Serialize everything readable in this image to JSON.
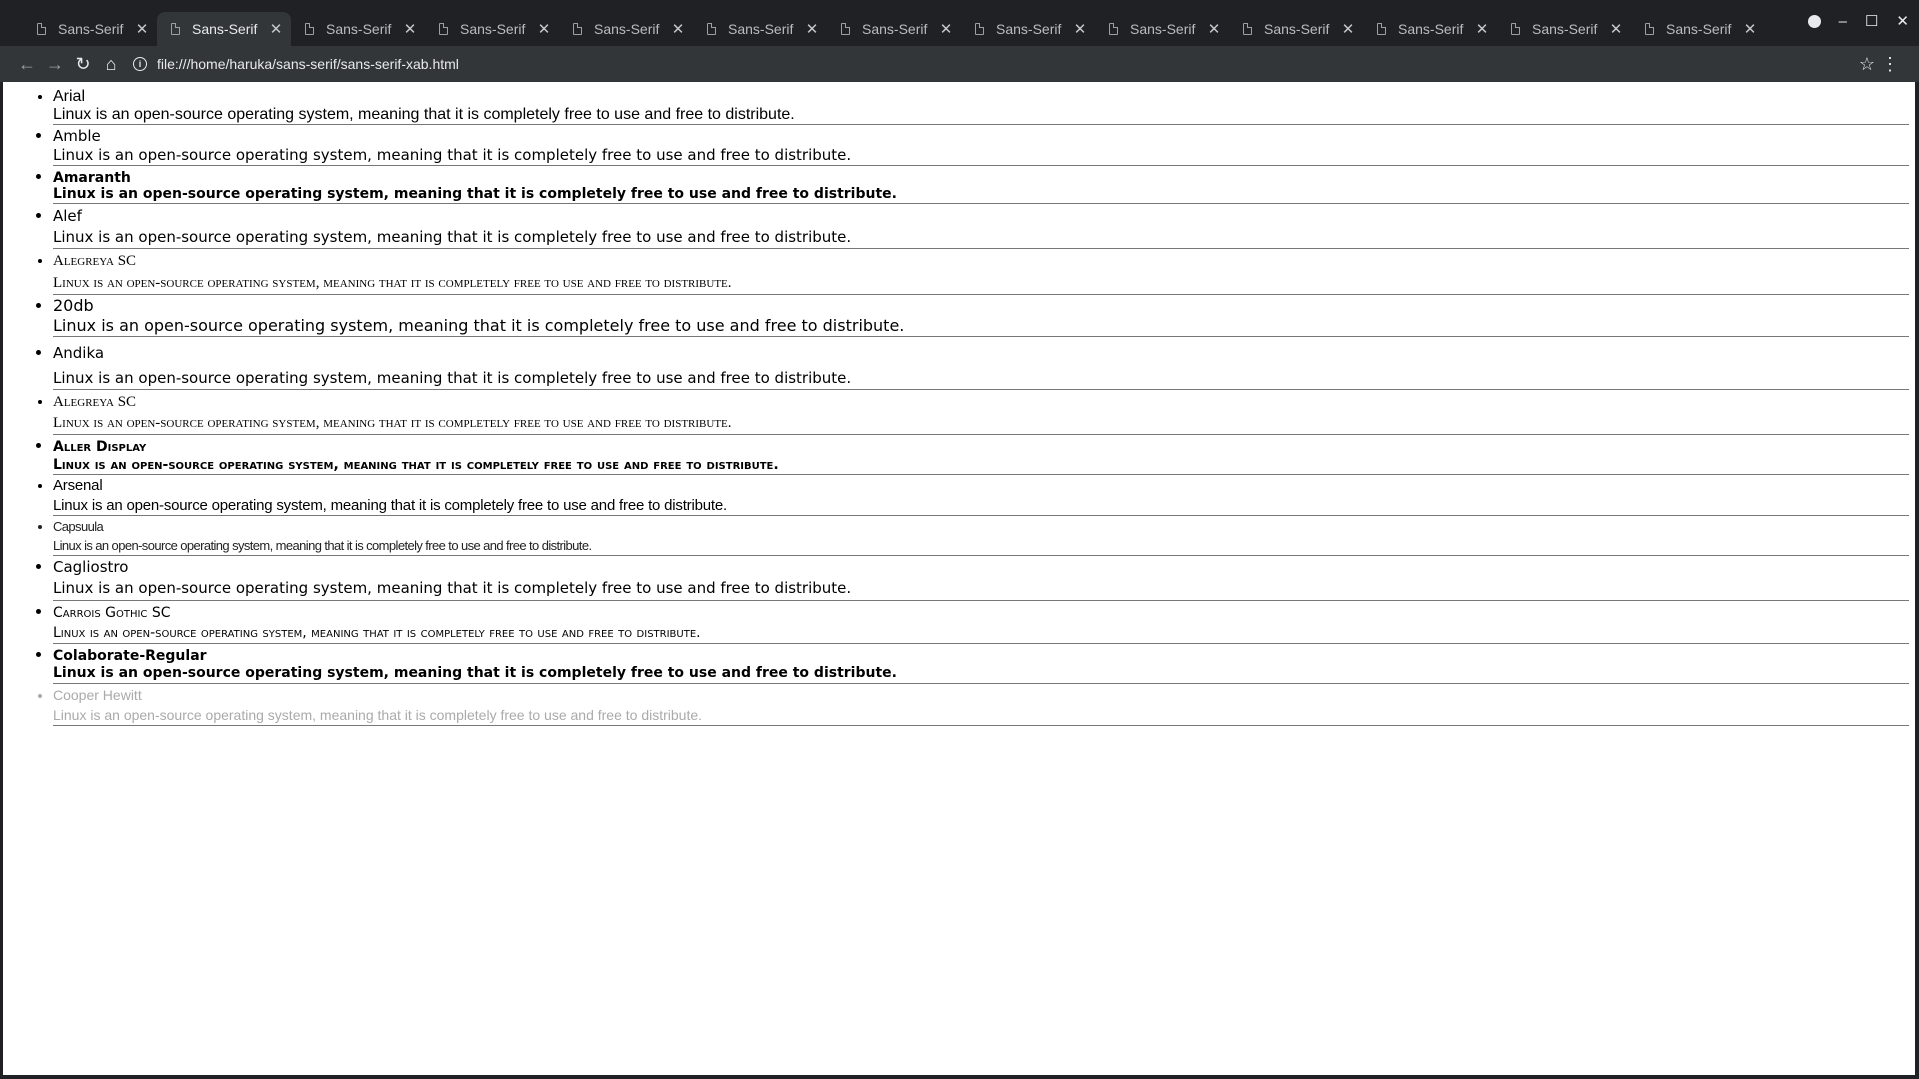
{
  "tabs": [
    {
      "title": "Sans-Serif",
      "active": false
    },
    {
      "title": "Sans-Serif",
      "active": true
    },
    {
      "title": "Sans-Serif",
      "active": false
    },
    {
      "title": "Sans-Serif",
      "active": false
    },
    {
      "title": "Sans-Serif",
      "active": false
    },
    {
      "title": "Sans-Serif",
      "active": false
    },
    {
      "title": "Sans-Serif",
      "active": false
    },
    {
      "title": "Sans-Serif",
      "active": false
    },
    {
      "title": "Sans-Serif",
      "active": false
    },
    {
      "title": "Sans-Serif",
      "active": false
    },
    {
      "title": "Sans-Serif",
      "active": false
    },
    {
      "title": "Sans-Serif",
      "active": false
    },
    {
      "title": "Sans-Serif",
      "active": false
    }
  ],
  "toolbar": {
    "url": "file:///home/haruka/sans-serif/sans-serif-xab.html"
  },
  "fonts": [
    {
      "name": "Arial",
      "sample": "Linux is an open-source operating system, meaning that it is completely free to use and free to distribute."
    },
    {
      "name": "Amble",
      "sample": "Linux is an open-source operating system, meaning that it is completely free to use and free to distribute."
    },
    {
      "name": "Amaranth",
      "sample": "Linux is an open-source operating system, meaning that it is completely free to use and free to distribute."
    },
    {
      "name": "Alef",
      "sample": "Linux is an open-source operating system, meaning that it is completely free to use and free to distribute."
    },
    {
      "name": "Alegreya SC",
      "sample": "Linux is an open-source operating system, meaning that it is completely free to use and free to distribute."
    },
    {
      "name": "20db",
      "sample": "Linux is an open-source operating system, meaning that it is completely free to use and free to distribute."
    },
    {
      "name": "Andika",
      "sample": "Linux is an open-source operating system, meaning that it is completely free to use and free to distribute."
    },
    {
      "name": "Alegreya SC",
      "sample": "Linux is an open-source operating system, meaning that it is completely free to use and free to distribute."
    },
    {
      "name": "Aller Display",
      "sample": "Linux is an open-source operating system, meaning that it is completely free to use and free to distribute."
    },
    {
      "name": "Arsenal",
      "sample": "Linux is an open-source operating system, meaning that it is completely free to use and free to distribute."
    },
    {
      "name": "Capsuula",
      "sample": "Linux is an open-source operating system, meaning that it is completely free to use and free to distribute."
    },
    {
      "name": "Cagliostro",
      "sample": "Linux is an open-source operating system, meaning that it is completely free to use and free to distribute."
    },
    {
      "name": "Carrois Gothic SC",
      "sample": "Linux is an open-source operating system, meaning that it is completely free to use and free to distribute."
    },
    {
      "name": "Colaborate-Regular",
      "sample": "Linux is an open-source operating system, meaning that it is completely free to use and free to distribute."
    },
    {
      "name": "Cooper Hewitt",
      "sample": "Linux is an open-source operating system, meaning that it is completely free to use and free to distribute."
    }
  ]
}
